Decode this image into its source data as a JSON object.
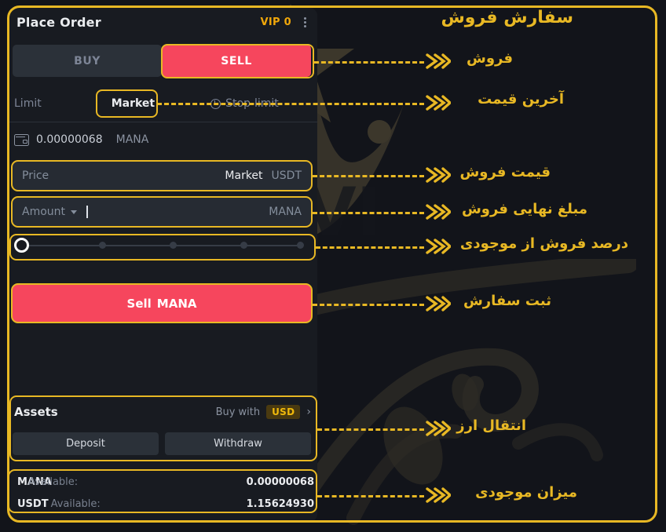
{
  "colors": {
    "gold": "#E8B824",
    "sell_red": "#F6465D",
    "panel_bg": "#1C1F26",
    "field_bg": "#262B33",
    "buy_bg": "#2B3139",
    "vip_amber": "#F0A70A",
    "usd_badge_text": "#F0B90B",
    "muted_text": "#848E9C"
  },
  "header": {
    "title": "Place Order",
    "vip": "VIP 0",
    "menu_icon": "kebab-menu-icon"
  },
  "side_tabs": {
    "buy": "BUY",
    "sell": "SELL",
    "active": "SELL"
  },
  "order_types": {
    "limit": "Limit",
    "market": "Market",
    "stop_limit": "Stop-limit",
    "active": "Market",
    "stop_icon": "clock-icon"
  },
  "wallet": {
    "icon": "wallet-icon",
    "amount": "0.00000068",
    "currency": "MANA"
  },
  "price_field": {
    "placeholder": "Price",
    "value": "",
    "mode": "Market",
    "unit": "USDT"
  },
  "amount_field": {
    "placeholder": "Amount",
    "value": "",
    "unit": "MANA",
    "dropdown_icon": "chevron-down-icon",
    "cursor": true
  },
  "slider": {
    "percent": 0,
    "ticks": [
      0,
      25,
      50,
      75,
      100
    ]
  },
  "submit": {
    "verb": "Sell",
    "symbol": "MANA"
  },
  "assets": {
    "title": "Assets",
    "buy_with_label": "Buy with",
    "buy_with_currency": "USD",
    "chevron": "›",
    "deposit": "Deposit",
    "withdraw": "Withdraw"
  },
  "balances": [
    {
      "symbol": "MANA",
      "label": "Available:",
      "value": "0.00000068"
    },
    {
      "symbol": "USDT",
      "label": "Available:",
      "value": "1.15624930"
    }
  ],
  "annotations": {
    "title": "سفارش فروش",
    "items": [
      {
        "text": "فروش"
      },
      {
        "text": "آخرین قیمت"
      },
      {
        "text": "قیمت فروش"
      },
      {
        "text": "مبلغ نهایی فروش"
      },
      {
        "text": "درصد فروش از موجودی"
      },
      {
        "text": "ثبت سفارش"
      },
      {
        "text": "انتقال ارز"
      },
      {
        "text": "میزان موجودی"
      }
    ]
  }
}
